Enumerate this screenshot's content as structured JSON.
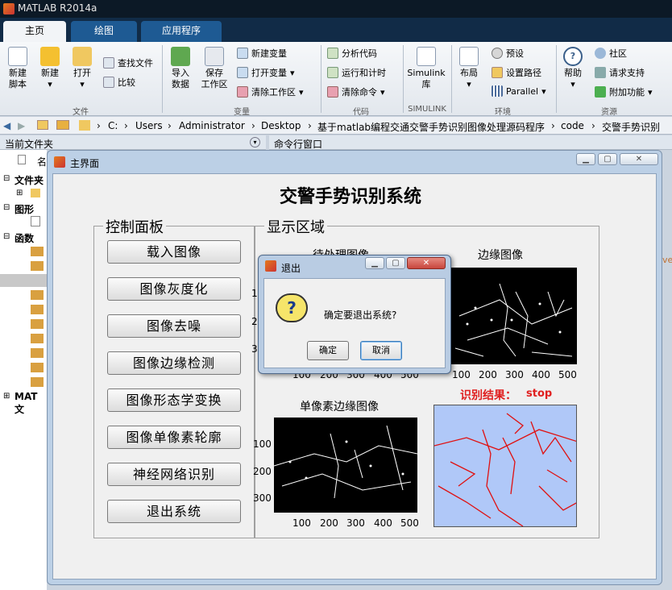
{
  "app": {
    "title": "MATLAB R2014a"
  },
  "tabs": [
    {
      "label": "主页"
    },
    {
      "label": "绘图"
    },
    {
      "label": "应用程序"
    }
  ],
  "ribbon": {
    "new_script": "新建\n脚本",
    "new": "新建",
    "open": "打开",
    "find_files": "查找文件",
    "compare": "比较",
    "import_data": "导入\n数据",
    "save_workspace": "保存\n工作区",
    "new_variable": "新建变量",
    "open_variable": "打开变量",
    "clear_workspace": "清除工作区",
    "analyze_code": "分析代码",
    "run_and_time": "运行和计时",
    "clear_commands": "清除命令",
    "simulink_library": "Simulink\n库",
    "layout": "布局",
    "preferences": "预设",
    "set_path": "设置路径",
    "parallel": "Parallel",
    "help": "帮助",
    "community": "社区",
    "request_support": "请求支持",
    "add_ons": "附加功能",
    "groups": {
      "file": "文件",
      "variable": "变量",
      "code": "代码",
      "simulink": "SIMULINK",
      "environment": "环境",
      "resources": "资源"
    }
  },
  "address": {
    "path": [
      "C:",
      "Users",
      "Administrator",
      "Desktop",
      "基于matlab编程交通交警手势识别图像处理源码程序",
      "code",
      "交警手势识别"
    ]
  },
  "current_folder": {
    "title": "当前文件夹",
    "name_col": "名",
    "sections": [
      "文件夹",
      "图形",
      "函数",
      "MAT 文"
    ]
  },
  "command_window": {
    "title": "命令行窗口",
    "stray_text": "ve"
  },
  "figure": {
    "window_title": "主界面",
    "app_title": "交警手势识别系统",
    "control_panel_title": "控制面板",
    "display_panel_title": "显示区域",
    "buttons": [
      "载入图像",
      "图像灰度化",
      "图像去噪",
      "图像边缘检测",
      "图像形态学变换",
      "图像单像素轮廓",
      "神经网络识别",
      "退出系统"
    ],
    "axes": {
      "original": {
        "title": "待处理图像"
      },
      "edge": {
        "title": "边缘图像"
      },
      "single_pixel": {
        "title": "单像素边缘图像"
      }
    },
    "xticks": [
      "100",
      "200",
      "300",
      "400",
      "500"
    ],
    "yticks": [
      "100",
      "200",
      "300"
    ],
    "result_label": "识别结果：",
    "result_value": "stop"
  },
  "dialog": {
    "title": "退出",
    "message": "确定要退出系统?",
    "ok": "确定",
    "cancel": "取消"
  },
  "colors": {
    "accent_blue": "#1e5a93",
    "result_red": "#e02020",
    "dialog_close": "#c9463d"
  }
}
